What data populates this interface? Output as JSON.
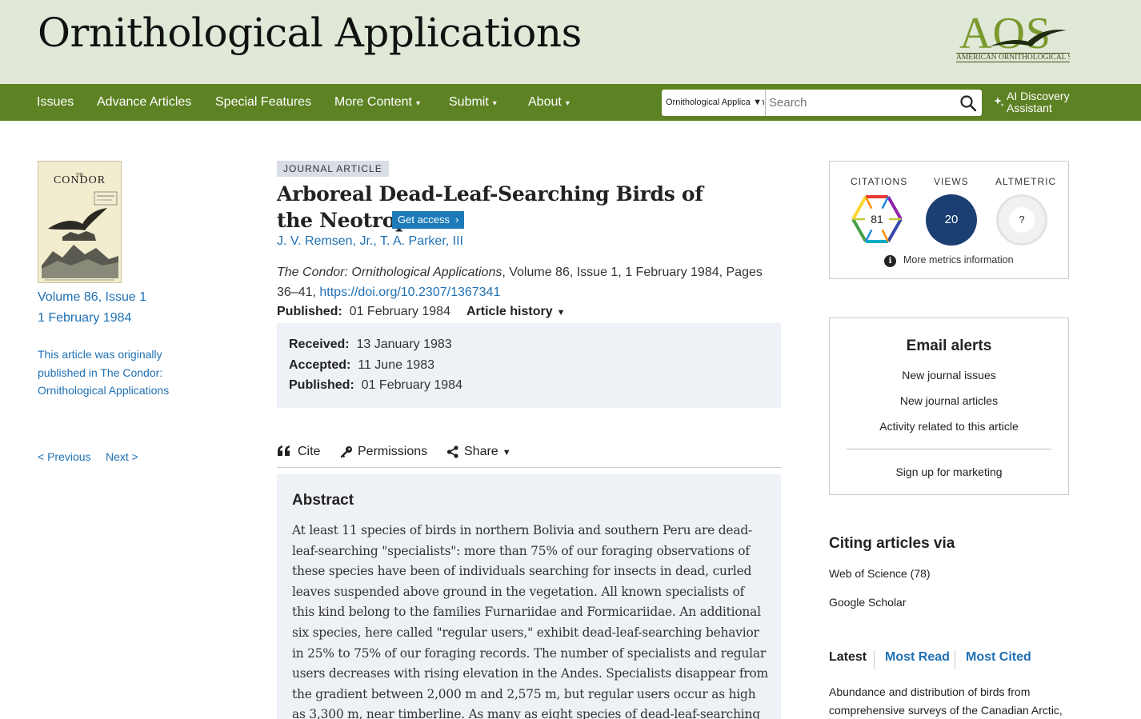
{
  "header": {
    "journal_title": "Ornithological Applications",
    "logo_letters": "AOS",
    "logo_name": "AMERICAN ORNITHOLOGICAL SOCIETY"
  },
  "nav": {
    "items": [
      "Issues",
      "Advance Articles",
      "Special Features",
      "More Content",
      "Submit",
      "About"
    ],
    "caret": "▾",
    "search_scope": "Ornithological Applications",
    "search_placeholder": "Search",
    "ai_line1": "AI Discovery",
    "ai_line2": "Assistant"
  },
  "sidebar": {
    "cover_the": "THE",
    "cover_title": "CONDOR",
    "volume": "Volume 86, Issue 1",
    "date": "1 February 1984",
    "original_note": "This article was originally published in The Condor: Ornithological Applications",
    "previous": "< Previous",
    "next": "Next >"
  },
  "article": {
    "type_badge": "JOURNAL ARTICLE",
    "title": "Arboreal Dead-Leaf-Searching Birds of the Neotropics",
    "get_access": "Get access",
    "authors": [
      "J. V. Remsen, Jr.",
      "T. A. Parker, III"
    ],
    "author_sep": ", ",
    "journal_name": "The Condor: Ornithological Applications",
    "citation_rest": ", Volume 86, Issue 1, 1 February 1984, Pages 36–41, ",
    "doi": "https://doi.org/10.2307/1367341",
    "published_label": "Published:",
    "published_value": "01 February 1984",
    "history_label": "Article history",
    "history": [
      {
        "label": "Received:",
        "value": "13 January 1983"
      },
      {
        "label": "Accepted:",
        "value": "11 June 1983"
      },
      {
        "label": "Published:",
        "value": "01 February 1984"
      }
    ],
    "tools": {
      "cite": "Cite",
      "permissions": "Permissions",
      "share": "Share"
    },
    "abstract_heading": "Abstract",
    "abstract_text": "At least 11 species of birds in northern Bolivia and southern Peru are dead-leaf-searching \"specialists\": more than 75% of our foraging observations of these species have been of individuals searching for insects in dead, curled leaves suspended above ground in the vegetation. All known specialists of this kind belong to the families Furnariidae and Formicariidae. An additional six species, here called \"regular users,\" exhibit dead-leaf-searching behavior in 25% to 75% of our foraging records. The number of specialists and regular users decreases with rising elevation in the Andes. Specialists disappear from the gradient between 2,000 m and 2,575 m, but regular users occur as high as 3,300 m, near timberline. As many as eight species of dead-leaf-searching specialists coexist in western"
  },
  "metrics": {
    "citations_label": "CITATIONS",
    "citations_value": "81",
    "views_label": "VIEWS",
    "views_value": "20",
    "altmetric_label": "ALTMETRIC",
    "altmetric_value": "?",
    "more_info": "More metrics information",
    "info_glyph": "i"
  },
  "alerts": {
    "title": "Email alerts",
    "links": [
      "New journal issues",
      "New journal articles",
      "Activity related to this article"
    ],
    "marketing": "Sign up for marketing"
  },
  "citing": {
    "title": "Citing articles via",
    "links": [
      "Web of Science (78)",
      "Google Scholar"
    ]
  },
  "latest": {
    "tabs": [
      "Latest",
      "Most Read",
      "Most Cited"
    ],
    "first_item": "Abundance and distribution of birds from comprehensive surveys of the Canadian Arctic,"
  },
  "colors": {
    "header_bg": "#e0e9d8",
    "nav_bg": "#5d8224",
    "link": "#1f70b4",
    "views_circle": "#1b3f73",
    "get_access": "#1c7ab9"
  }
}
